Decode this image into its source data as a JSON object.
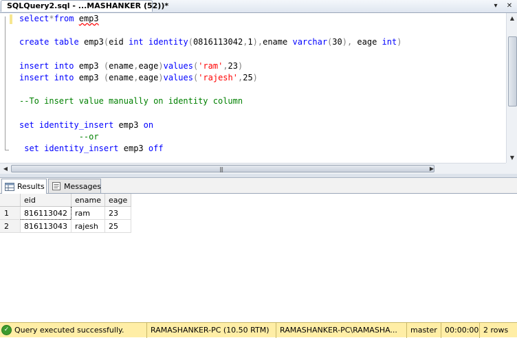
{
  "document_tab": {
    "title": "SQLQuery2.sql - ...MASHANKER (52))*"
  },
  "tab_controls": {
    "dropdown_icon": "▾",
    "close_icon": "✕"
  },
  "editor": {
    "lines": [
      [
        {
          "t": "select",
          "c": "kw"
        },
        {
          "t": "*",
          "c": "gray"
        },
        {
          "t": "from",
          "c": "kw"
        },
        {
          "t": " "
        },
        {
          "t": "emp3",
          "c": "squiggle"
        }
      ],
      [],
      [
        {
          "t": "create",
          "c": "kw"
        },
        {
          "t": " "
        },
        {
          "t": "table",
          "c": "kw"
        },
        {
          "t": " emp3"
        },
        {
          "t": "(",
          "c": "gray"
        },
        {
          "t": "eid "
        },
        {
          "t": "int",
          "c": "kw"
        },
        {
          "t": " "
        },
        {
          "t": "identity",
          "c": "kw"
        },
        {
          "t": "(",
          "c": "gray"
        },
        {
          "t": "0816113042"
        },
        {
          "t": ",",
          "c": "gray"
        },
        {
          "t": "1"
        },
        {
          "t": "),",
          "c": "gray"
        },
        {
          "t": "ename "
        },
        {
          "t": "varchar",
          "c": "kw"
        },
        {
          "t": "(",
          "c": "gray"
        },
        {
          "t": "30"
        },
        {
          "t": "),",
          "c": "gray"
        },
        {
          "t": " eage "
        },
        {
          "t": "int",
          "c": "kw"
        },
        {
          "t": ")",
          "c": "gray"
        }
      ],
      [],
      [
        {
          "t": "insert",
          "c": "kw"
        },
        {
          "t": " "
        },
        {
          "t": "into",
          "c": "kw"
        },
        {
          "t": " emp3 "
        },
        {
          "t": "(",
          "c": "gray"
        },
        {
          "t": "ename"
        },
        {
          "t": ",",
          "c": "gray"
        },
        {
          "t": "eage"
        },
        {
          "t": ")",
          "c": "gray"
        },
        {
          "t": "values",
          "c": "kw"
        },
        {
          "t": "(",
          "c": "gray"
        },
        {
          "t": "'ram'",
          "c": "str"
        },
        {
          "t": ",",
          "c": "gray"
        },
        {
          "t": "23"
        },
        {
          "t": ")",
          "c": "gray"
        }
      ],
      [
        {
          "t": "insert",
          "c": "kw"
        },
        {
          "t": " "
        },
        {
          "t": "into",
          "c": "kw"
        },
        {
          "t": " emp3 "
        },
        {
          "t": "(",
          "c": "gray"
        },
        {
          "t": "ename"
        },
        {
          "t": ",",
          "c": "gray"
        },
        {
          "t": "eage"
        },
        {
          "t": ")",
          "c": "gray"
        },
        {
          "t": "values",
          "c": "kw"
        },
        {
          "t": "(",
          "c": "gray"
        },
        {
          "t": "'rajesh'",
          "c": "str"
        },
        {
          "t": ",",
          "c": "gray"
        },
        {
          "t": "25"
        },
        {
          "t": ")",
          "c": "gray"
        }
      ],
      [],
      [
        {
          "t": "--To insert value manually on identity column",
          "c": "cmt"
        }
      ],
      [],
      [
        {
          "t": "set",
          "c": "kw"
        },
        {
          "t": " "
        },
        {
          "t": "identity_insert",
          "c": "kw"
        },
        {
          "t": " emp3 "
        },
        {
          "t": "on",
          "c": "kw"
        }
      ],
      [
        {
          "t": "            "
        },
        {
          "t": "--or",
          "c": "cmt"
        }
      ],
      [
        {
          "t": " "
        },
        {
          "t": "set",
          "c": "kw"
        },
        {
          "t": " "
        },
        {
          "t": "identity_insert",
          "c": "kw"
        },
        {
          "t": " emp3 "
        },
        {
          "t": "off",
          "c": "kw"
        }
      ]
    ]
  },
  "scrollbars": {
    "up_arrow": "▲",
    "down_arrow": "▼",
    "left_arrow": "◀",
    "right_arrow": "▶",
    "grip": "|||"
  },
  "result_tabs": [
    {
      "label": "Results"
    },
    {
      "label": "Messages"
    }
  ],
  "grid": {
    "columns": [
      "eid",
      "ename",
      "eage"
    ],
    "rows": [
      {
        "num": "1",
        "cells": [
          "816113042",
          "ram",
          "23"
        ]
      },
      {
        "num": "2",
        "cells": [
          "816113043",
          "rajesh",
          "25"
        ]
      }
    ]
  },
  "status_bar": {
    "message": "Query executed successfully.",
    "server": "RAMASHANKER-PC (10.50 RTM)",
    "login": "RAMASHANKER-PC\\RAMASHA...",
    "database": "master",
    "elapsed": "00:00:00",
    "row_count": "2 rows"
  }
}
